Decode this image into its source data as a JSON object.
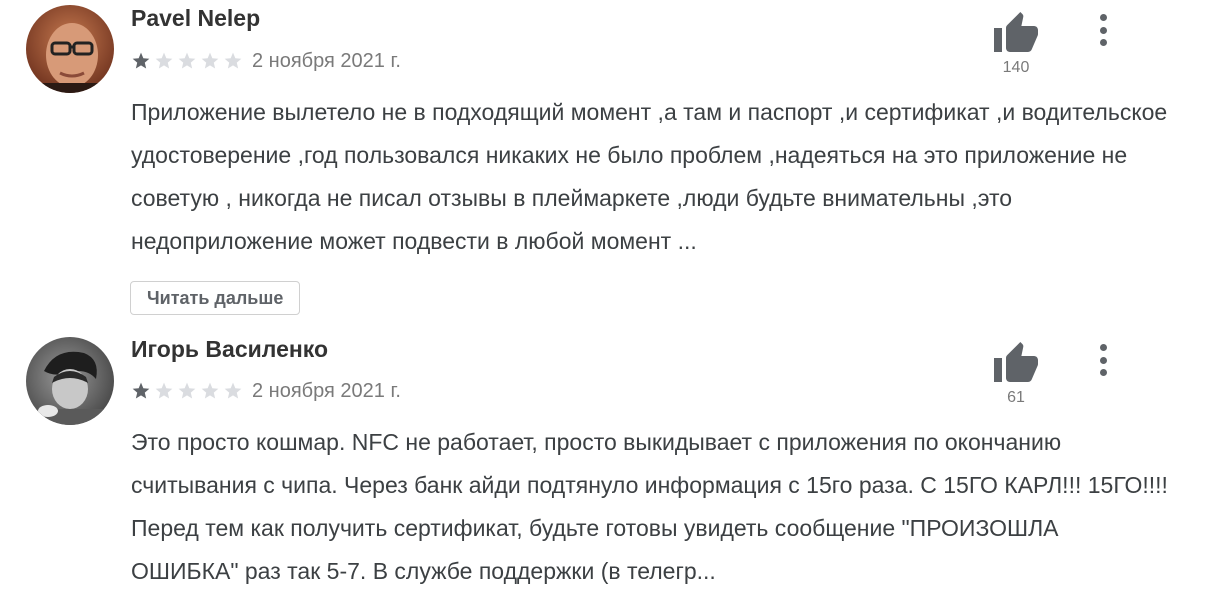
{
  "reviews": [
    {
      "author": "Pavel Nelep",
      "avatar": "avatar-photo-man-glasses",
      "rating": 1,
      "max_rating": 5,
      "date": "2 ноября 2021 г.",
      "likes": "140",
      "text": "Приложение вылетело не в подходящий момент ,а там и паспорт ,и сертификат ,и водительское удостоверение ,год пользовался никаких не было проблем ,надеяться на это приложение не советую , никогда не писал отзывы в плеймаркете ,люди будьте внимательны ,это недоприложение может подвести в любой момент ...",
      "read_more": "Читать дальше"
    },
    {
      "author": "Игорь Василенко",
      "avatar": "avatar-photo-grayscale",
      "rating": 1,
      "max_rating": 5,
      "date": "2 ноября 2021 г.",
      "likes": "61",
      "text": "Это просто кошмар. NFC не работает, просто выкидывает с приложения по окончанию считывания с чипа. Через банк айди подтянуло информация с 15го раза. С 15ГО КАРЛ!!! 15ГО!!!! Перед тем как получить сертификат, будьте готовы увидеть сообщение \"ПРОИЗОШЛА ОШИБКА\" раз так 5-7. В службе поддержки (в телегр..."
    }
  ],
  "colors": {
    "star_filled": "#5f6368",
    "star_empty": "#dadce0",
    "thumb": "#5f6368"
  },
  "icons": {
    "like": "thumbs-up-icon",
    "more": "more-vert-icon",
    "star": "star-icon"
  }
}
